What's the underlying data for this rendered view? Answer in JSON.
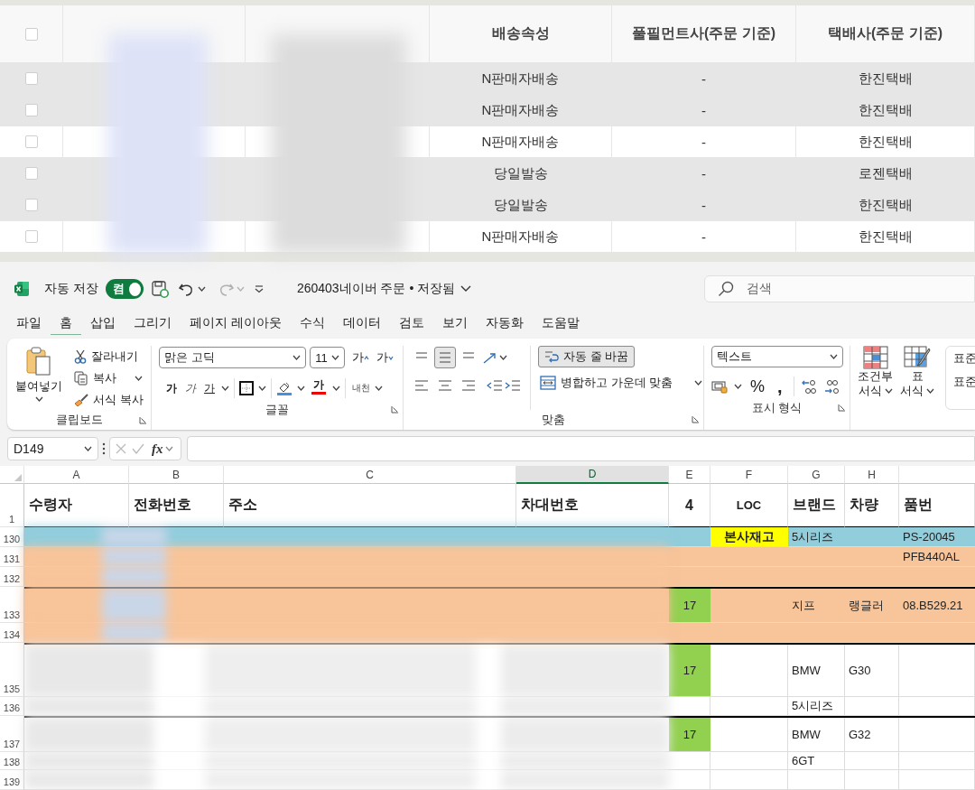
{
  "order_table": {
    "header_checkbox": {
      "checked": false
    },
    "columns": [
      {
        "kind": "blurred"
      },
      {
        "kind": "blurred"
      },
      {
        "kind": "text",
        "label": "배송속성"
      },
      {
        "kind": "text",
        "label": "풀필먼트사(주문 기준)"
      },
      {
        "kind": "text",
        "label": "택배사(주문 기준)"
      }
    ],
    "rows": [
      {
        "checked": false,
        "shaded": true,
        "cells": [
          "",
          "",
          "N판매자배송",
          "-",
          "한진택배"
        ]
      },
      {
        "checked": false,
        "shaded": true,
        "cells": [
          "",
          "",
          "N판매자배송",
          "-",
          "한진택배"
        ]
      },
      {
        "checked": false,
        "shaded": false,
        "cells": [
          "",
          "",
          "N판매자배송",
          "-",
          "한진택배"
        ]
      },
      {
        "checked": false,
        "shaded": true,
        "cells": [
          "",
          "",
          "당일발송",
          "-",
          "로젠택배"
        ]
      },
      {
        "checked": false,
        "shaded": true,
        "cells": [
          "",
          "",
          "당일발송",
          "-",
          "한진택배"
        ]
      },
      {
        "checked": false,
        "shaded": false,
        "cells": [
          "",
          "",
          "N판매자배송",
          "-",
          "한진택배"
        ]
      }
    ]
  },
  "excel": {
    "title_bar": {
      "autosave_label": "자동 저장",
      "autosave_on": true,
      "toggle_text": "켬",
      "redo_disabled": true,
      "document_title": "260403네이버 주문 • 저장됨",
      "search_placeholder": "검색"
    },
    "menu_tabs": [
      {
        "label": "파일",
        "selected": false
      },
      {
        "label": "홈",
        "selected": true
      },
      {
        "label": "삽입",
        "selected": false
      },
      {
        "label": "그리기",
        "selected": false
      },
      {
        "label": "페이지 레이아웃",
        "selected": false
      },
      {
        "label": "수식",
        "selected": false
      },
      {
        "label": "데이터",
        "selected": false
      },
      {
        "label": "검토",
        "selected": false
      },
      {
        "label": "보기",
        "selected": false
      },
      {
        "label": "자동화",
        "selected": false
      },
      {
        "label": "도움말",
        "selected": false
      }
    ],
    "ribbon": {
      "clipboard": {
        "label": "클립보드",
        "paste": "붙여넣기",
        "cut": "잘라내기",
        "copy": "복사",
        "format_painter": "서식 복사"
      },
      "font": {
        "label": "글꼴",
        "font_name": "맑은 고딕",
        "font_size": "11",
        "grow": "가",
        "shrink": "가",
        "bold": "가",
        "italic": "가",
        "underline": "가",
        "font_color": "가",
        "phonetic": "내천"
      },
      "alignment": {
        "label": "맞춤",
        "middle_selected": true,
        "wrap_text": "자동 줄 바꿈",
        "wrap_selected": true,
        "merge": "병합하고 가운데 맞춤"
      },
      "number": {
        "label": "표시 형식",
        "format": "텍스트",
        "percent": "%",
        "comma": ","
      },
      "styles": {
        "conditional": [
          "조건부",
          "서식"
        ],
        "table": [
          "표",
          "서식"
        ],
        "cell_styles": [
          "표준",
          "표준"
        ]
      }
    },
    "formula_bar": {
      "name_box": "D149",
      "function_label": "fx"
    },
    "columns": [
      {
        "letter": "A",
        "selected": false
      },
      {
        "letter": "B",
        "selected": false
      },
      {
        "letter": "C",
        "selected": false
      },
      {
        "letter": "D",
        "selected": true
      },
      {
        "letter": "E",
        "selected": false
      },
      {
        "letter": "F",
        "selected": false
      },
      {
        "letter": "G",
        "selected": false
      },
      {
        "letter": "H",
        "selected": false
      }
    ],
    "header_row": {
      "number": "1",
      "cells": [
        "수령자",
        "전화번호",
        "주소",
        "차대번호",
        "4",
        "LOC",
        "브랜드",
        "차량",
        "품번"
      ]
    },
    "rows": [
      {
        "number": "130",
        "color": "#92cddc",
        "thick_top": false,
        "cells": {
          "F": {
            "text": "본사재고",
            "color": "#ffff00"
          },
          "G": {
            "text": "5시리즈"
          },
          "I": {
            "text": "PS-20045"
          }
        }
      },
      {
        "number": "131",
        "color": "#f8c49a",
        "thick_top": false,
        "cells": {
          "I": {
            "text": "PFB440AL"
          }
        }
      },
      {
        "number": "132",
        "color": "#f8c49a",
        "thick_top": false,
        "cells": {}
      },
      {
        "number": "133",
        "color": "#f8c49a",
        "thick_top": true,
        "cells": {
          "E": {
            "text": "17",
            "color": "#92d050"
          },
          "G": {
            "text": "지프"
          },
          "H": {
            "text": "랭글러"
          },
          "I": {
            "text": "08.B529.21"
          }
        }
      },
      {
        "number": "134",
        "color": "#f8c49a",
        "thick_top": false,
        "cells": {}
      },
      {
        "number": "135",
        "color": "#ffffff",
        "thick_top": true,
        "cells": {
          "E": {
            "text": "17",
            "color": "#92d050"
          },
          "G": {
            "text": "BMW"
          },
          "H": {
            "text": "G30"
          }
        }
      },
      {
        "number": "136",
        "color": "#ffffff",
        "thick_top": false,
        "cells": {
          "G": {
            "text": "5시리즈"
          }
        }
      },
      {
        "number": "137",
        "color": "#ffffff",
        "thick_top": true,
        "cells": {
          "E": {
            "text": "17",
            "color": "#92d050"
          },
          "G": {
            "text": "BMW"
          },
          "H": {
            "text": "G32"
          }
        }
      },
      {
        "number": "138",
        "color": "#ffffff",
        "thick_top": false,
        "cells": {
          "G": {
            "text": "6GT"
          }
        }
      },
      {
        "number": "139",
        "color": "#ffffff",
        "thick_top": false,
        "cells": {}
      }
    ]
  }
}
